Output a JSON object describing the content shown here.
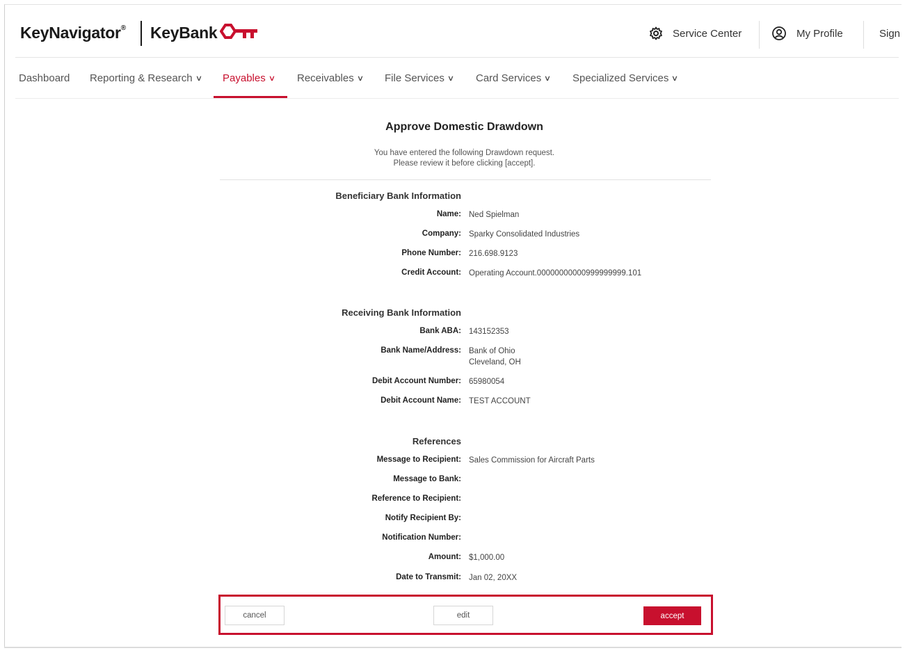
{
  "header": {
    "brand_keynavigator": "KeyNavigator",
    "brand_registered": "®",
    "brand_keybank": "KeyBank",
    "service_center": "Service Center",
    "my_profile": "My Profile",
    "sign_out_partial": "Sign"
  },
  "nav": {
    "items": [
      {
        "label": "Dashboard",
        "has_menu": false
      },
      {
        "label": "Reporting & Research",
        "has_menu": true
      },
      {
        "label": "Payables",
        "has_menu": true,
        "active": true
      },
      {
        "label": "Receivables",
        "has_menu": true
      },
      {
        "label": "File Services",
        "has_menu": true
      },
      {
        "label": "Card Services",
        "has_menu": true
      },
      {
        "label": "Specialized Services",
        "has_menu": true
      }
    ]
  },
  "page": {
    "title": "Approve Domestic Drawdown",
    "intro_line1": "You have entered the following Drawdown request.",
    "intro_line2": "Please review it before clicking [accept]."
  },
  "beneficiary": {
    "heading": "Beneficiary Bank Information",
    "name_label": "Name:",
    "name_value": "Ned Spielman",
    "company_label": "Company:",
    "company_value": "Sparky Consolidated Industries",
    "phone_label": "Phone Number:",
    "phone_value": "216.698.9123",
    "credit_label": "Credit Account:",
    "credit_value": "Operating Account.00000000000999999999.101"
  },
  "receiving": {
    "heading": "Receiving Bank Information",
    "aba_label": "Bank ABA:",
    "aba_value": "143152353",
    "name_address_label": "Bank Name/Address:",
    "name_value": "Bank of Ohio",
    "address_value": "Cleveland, OH",
    "debit_number_label": "Debit Account Number:",
    "debit_number_value": "65980054",
    "debit_name_label": "Debit Account Name:",
    "debit_name_value": "TEST ACCOUNT"
  },
  "references": {
    "heading": "References",
    "msg_recipient_label": "Message to Recipient:",
    "msg_recipient_value": "Sales Commission for Aircraft Parts",
    "msg_bank_label": "Message to Bank:",
    "ref_recipient_label": "Reference to Recipient:",
    "notify_label": "Notify Recipient By:",
    "notification_number_label": "Notification Number:",
    "amount_label": "Amount:",
    "amount_value": "$1,000.00",
    "date_label": "Date to Transmit:",
    "date_value": "Jan 02, 20XX"
  },
  "actions": {
    "cancel": "cancel",
    "edit": "edit",
    "accept": "accept"
  },
  "colors": {
    "brand_red": "#c8102e"
  },
  "icons": {
    "brand": "keybank-key-icon",
    "service_center": "gear-icon",
    "profile": "user-circle-icon",
    "menu": "chevron-down-icon"
  }
}
